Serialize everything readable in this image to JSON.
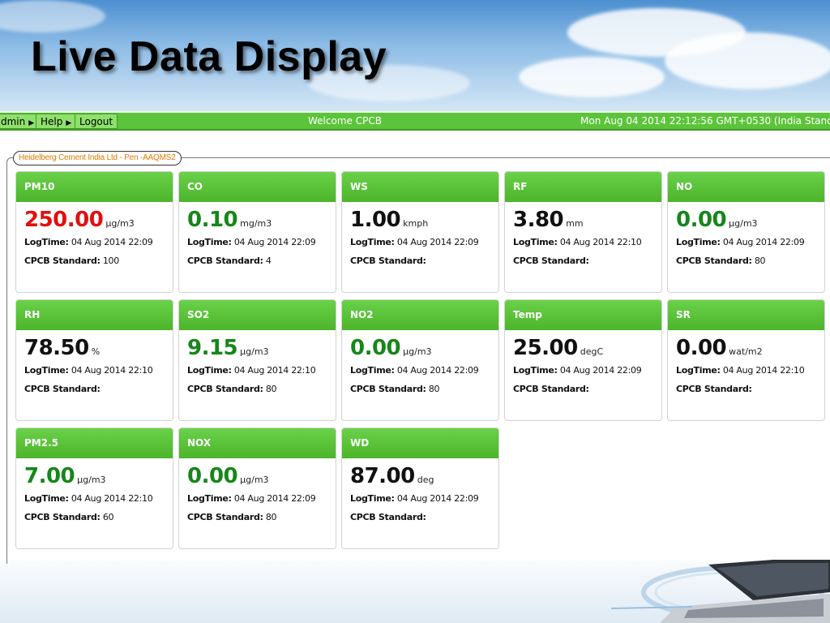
{
  "slide_title": "Live Data Display",
  "menu": {
    "admin": "dmin",
    "help": "Help",
    "logout": "Logout",
    "welcome": "Welcome CPCB",
    "datetime": "Mon Aug 04 2014 22:12:56 GMT+0530 (India Standa"
  },
  "station": "Heidelberg Cement India Ltd - Pen -AAQMS2",
  "labels": {
    "logtime": "LogTime:",
    "standard": "CPCB Standard:"
  },
  "colors": {
    "header_green": "#5cc43a",
    "value_red": "#e01010",
    "value_green": "#17861a",
    "station_orange": "#e07b00"
  },
  "cards": [
    {
      "name": "PM10",
      "value": "250.00",
      "unit": "μg/m3",
      "logtime": "04 Aug 2014 22:09",
      "standard": "100",
      "color": "red"
    },
    {
      "name": "CO",
      "value": "0.10",
      "unit": "mg/m3",
      "logtime": "04 Aug 2014 22:09",
      "standard": "4",
      "color": "green"
    },
    {
      "name": "WS",
      "value": "1.00",
      "unit": "kmph",
      "logtime": "04 Aug 2014 22:09",
      "standard": "",
      "color": "black"
    },
    {
      "name": "RF",
      "value": "3.80",
      "unit": "mm",
      "logtime": "04 Aug 2014 22:10",
      "standard": "",
      "color": "black"
    },
    {
      "name": "NO",
      "value": "0.00",
      "unit": "μg/m3",
      "logtime": "04 Aug 2014 22:09",
      "standard": "80",
      "color": "green"
    },
    {
      "name": "RH",
      "value": "78.50",
      "unit": "%",
      "logtime": "04 Aug 2014 22:10",
      "standard": "",
      "color": "black"
    },
    {
      "name": "SO2",
      "value": "9.15",
      "unit": "μg/m3",
      "logtime": "04 Aug 2014 22:10",
      "standard": "80",
      "color": "green"
    },
    {
      "name": "NO2",
      "value": "0.00",
      "unit": "μg/m3",
      "logtime": "04 Aug 2014 22:09",
      "standard": "80",
      "color": "green"
    },
    {
      "name": "Temp",
      "value": "25.00",
      "unit": "degC",
      "logtime": "04 Aug 2014 22:09",
      "standard": "",
      "color": "black"
    },
    {
      "name": "SR",
      "value": "0.00",
      "unit": "wat/m2",
      "logtime": "04 Aug 2014 22:10",
      "standard": "",
      "color": "black"
    },
    {
      "name": "PM2.5",
      "value": "7.00",
      "unit": "μg/m3",
      "logtime": "04 Aug 2014 22:10",
      "standard": "60",
      "color": "green"
    },
    {
      "name": "NOX",
      "value": "0.00",
      "unit": "μg/m3",
      "logtime": "04 Aug 2014 22:09",
      "standard": "80",
      "color": "green"
    },
    {
      "name": "WD",
      "value": "87.00",
      "unit": "deg",
      "logtime": "04 Aug 2014 22:09",
      "standard": "",
      "color": "black"
    }
  ]
}
